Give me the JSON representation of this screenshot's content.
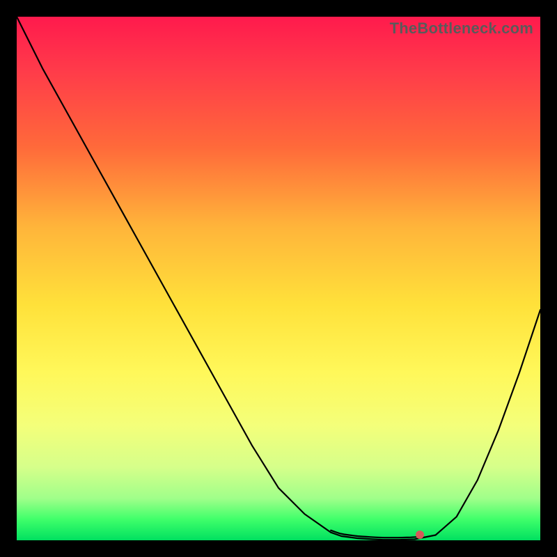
{
  "watermark": "TheBottleneck.com",
  "colors": {
    "gradient_top": "#ff1a4d",
    "gradient_bottom": "#00e060",
    "curve": "#000000",
    "marker": "#d65a5a",
    "frame": "#000000"
  },
  "chart_data": {
    "type": "line",
    "title": "",
    "xlabel": "",
    "ylabel": "",
    "x": [
      0.0,
      0.05,
      0.1,
      0.15,
      0.2,
      0.25,
      0.3,
      0.35,
      0.4,
      0.45,
      0.5,
      0.55,
      0.6,
      0.62,
      0.65,
      0.68,
      0.7,
      0.73,
      0.76,
      0.8,
      0.84,
      0.88,
      0.92,
      0.96,
      1.0
    ],
    "values": [
      1.0,
      0.9,
      0.81,
      0.72,
      0.63,
      0.54,
      0.45,
      0.36,
      0.27,
      0.18,
      0.1,
      0.05,
      0.015,
      0.008,
      0.004,
      0.002,
      0.001,
      0.001,
      0.002,
      0.01,
      0.045,
      0.115,
      0.21,
      0.32,
      0.44
    ],
    "xlim": [
      0,
      1
    ],
    "ylim": [
      0,
      1
    ],
    "optimum_range_x": [
      0.6,
      0.77
    ],
    "optimum_end_dot_x": 0.77,
    "grid": false,
    "legend": false
  }
}
